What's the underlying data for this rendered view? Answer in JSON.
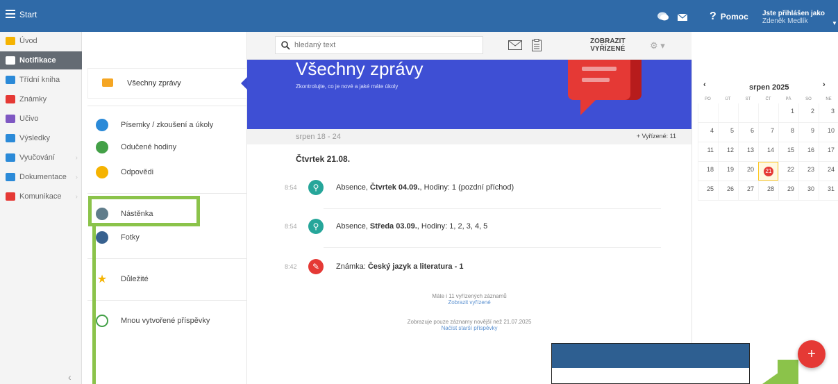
{
  "topbar": {
    "start": "Start",
    "help": "Pomoc",
    "user_label": "Jste přihlášen jako",
    "user_name": "Zdeněk Medlík"
  },
  "leftnav": {
    "items": [
      {
        "label": "Úvod",
        "icon": "star-icon",
        "color": "#f5b301"
      },
      {
        "label": "Notifikace",
        "icon": "envelope-icon",
        "color": "#ffffff",
        "active": true
      },
      {
        "label": "Třídní kniha",
        "icon": "book-icon",
        "color": "#2b8ad8"
      },
      {
        "label": "Známky",
        "icon": "grades-icon",
        "color": "#e53935"
      },
      {
        "label": "Učivo",
        "icon": "graduation-icon",
        "color": "#7e57c2"
      },
      {
        "label": "Výsledky",
        "icon": "chart-icon",
        "color": "#2b8ad8"
      },
      {
        "label": "Vyučování",
        "icon": "classroom-icon",
        "color": "#2b8ad8"
      },
      {
        "label": "Dokumentace",
        "icon": "document-icon",
        "color": "#2b8ad8"
      },
      {
        "label": "Komunikace",
        "icon": "people-icon",
        "color": "#e53935"
      }
    ]
  },
  "subnav": {
    "selected": "Všechny zprávy",
    "items": [
      {
        "label": "Písemky / zkoušení a úkoly",
        "color": "#2b8ad8"
      },
      {
        "label": "Odučené hodiny",
        "color": "#43a047"
      },
      {
        "label": "Odpovědi",
        "color": "#f5b301"
      },
      {
        "label": "Nástěnka",
        "color": "#607d8b"
      },
      {
        "label": "Fotky",
        "color": "#37618f"
      },
      {
        "label": "Důležité",
        "color": "#f5b301"
      },
      {
        "label": "Mnou vytvořené příspěvky",
        "color": "#43a047"
      }
    ]
  },
  "search": {
    "placeholder": "hledaný text",
    "zobrazit": "ZOBRAZIT",
    "vyrizene": "VYŘÍZENÉ"
  },
  "hero": {
    "title": "Všechny zprávy",
    "subtitle": "Zkontrolujte, co je nové a jaké máte úkoly"
  },
  "week": {
    "range": "srpen 18 - 24",
    "vyrizene": "+ Vyřízené: 11"
  },
  "feed": {
    "day": "Čtvrtek 21.08.",
    "entries": [
      {
        "time": "8:54",
        "prefix": "Absence, ",
        "bold": "Čtvrtek 04.09.",
        "suffix": ", Hodiny: 1 (pozdní příchod)",
        "color": "#26a69a"
      },
      {
        "time": "8:54",
        "prefix": "Absence, ",
        "bold": "Středa 03.09.",
        "suffix": ", Hodiny: 1, 2, 3, 4, 5",
        "color": "#26a69a"
      },
      {
        "time": "8:42",
        "prefix": "Známka: ",
        "bold": "Český jazyk a literatura - 1",
        "suffix": "",
        "color": "#e53935"
      }
    ],
    "info1": "Máte i 11 vyřízených záznamů",
    "info1_link": "Zobrazit vyřízené",
    "info2": "Zobrazuje pouze záznamy novější než 21.07.2025",
    "info2_link": "Načíst starší příspěvky"
  },
  "calendar": {
    "month": "srpen 2025",
    "dow": [
      "PO",
      "ÚT",
      "ST",
      "ČT",
      "PÁ",
      "SO",
      "NE"
    ],
    "weeks": [
      [
        "",
        "",
        "",
        "",
        "1",
        "2",
        "3"
      ],
      [
        "4",
        "5",
        "6",
        "7",
        "8",
        "9",
        "10"
      ],
      [
        "11",
        "12",
        "13",
        "14",
        "15",
        "16",
        "17"
      ],
      [
        "18",
        "19",
        "20",
        "21",
        "22",
        "23",
        "24"
      ],
      [
        "25",
        "26",
        "27",
        "28",
        "29",
        "30",
        "31"
      ]
    ],
    "today": "21"
  },
  "fab": "+"
}
